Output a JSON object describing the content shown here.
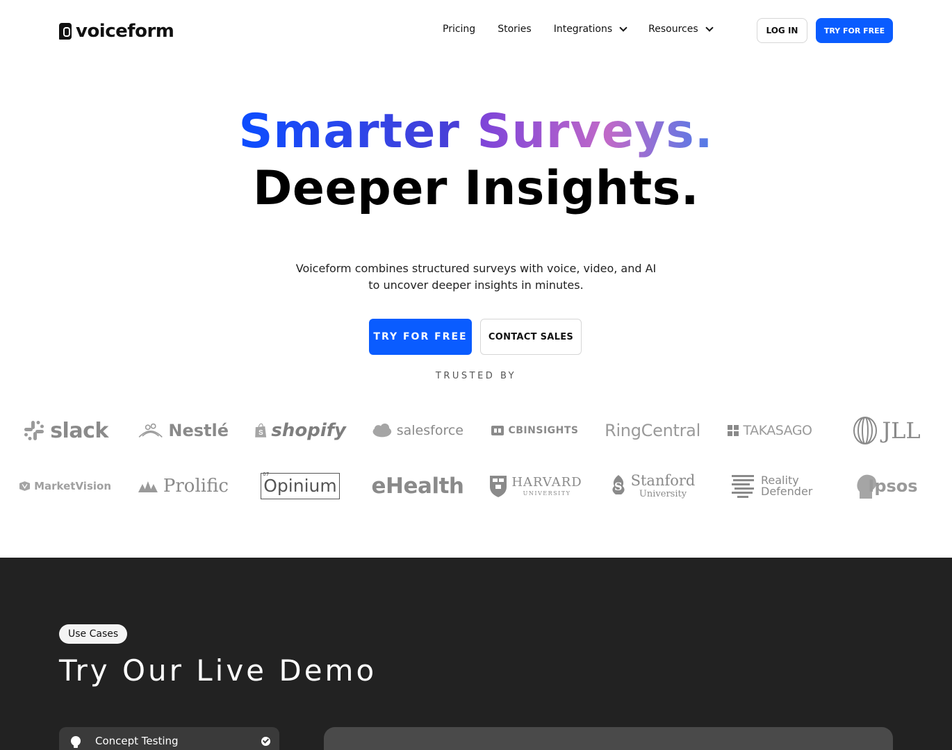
{
  "header": {
    "logo_text": "voiceform",
    "nav": [
      {
        "label": "Pricing",
        "has_dropdown": false
      },
      {
        "label": "Stories",
        "has_dropdown": false
      },
      {
        "label": "Integrations",
        "has_dropdown": true
      },
      {
        "label": "Resources",
        "has_dropdown": true
      }
    ],
    "login_label": "LOG IN",
    "try_label": "TRY FOR FREE"
  },
  "hero": {
    "word1": "Smarter",
    "word2": "Surveys.",
    "line2": "Deeper Insights.",
    "subtitle": "Voiceform combines structured surveys with voice, video, and AI to uncover deeper insights in minutes.",
    "cta_primary": "TRY FOR FREE",
    "cta_secondary": "CONTACT SALES",
    "trusted_label": "TRUSTED BY"
  },
  "trusted_logos": {
    "row1": [
      "slack",
      "Nestlé",
      "shopify",
      "salesforce",
      "CBINSIGHTS",
      "RingCentral",
      "TAKASAGO",
      "JLL"
    ],
    "row2": [
      "MarketVision",
      "Prolific",
      "Opinium",
      "eHealth",
      "HARVARD",
      "Stanford",
      "Reality Defender",
      "Ipsos"
    ],
    "row2_sub": {
      "harvard": "UNIVERSITY",
      "stanford": "University",
      "opinium_small": "07"
    }
  },
  "use_cases": {
    "pill_label": "Use Cases",
    "title": "Try Our Live Demo",
    "items": [
      {
        "label": "Concept Testing",
        "icon": "lightbulb-icon",
        "selected": true
      }
    ]
  },
  "colors": {
    "accent": "#0a5cff",
    "dark_bg": "#222222",
    "logo_gray": "#8a8a8a"
  }
}
